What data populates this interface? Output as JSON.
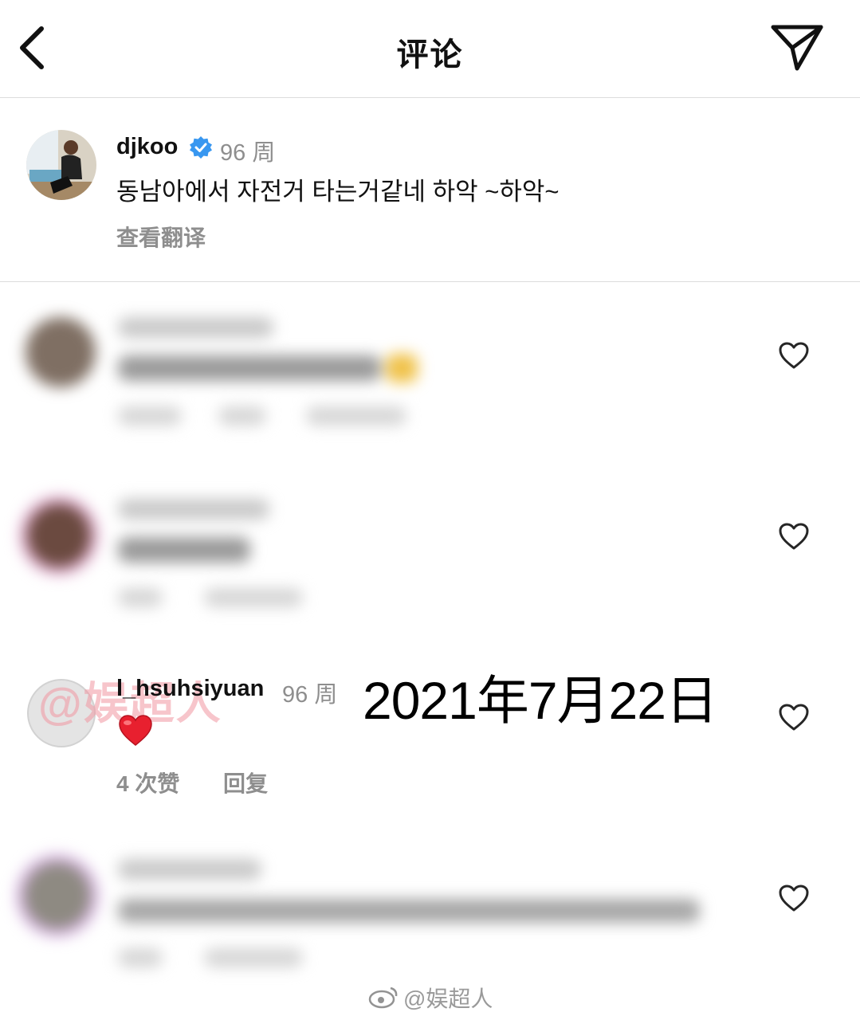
{
  "header": {
    "title": "评论",
    "back_icon": "chevron-left-icon",
    "send_icon": "paper-plane-icon"
  },
  "caption": {
    "username": "djkoo",
    "verified_icon": "verified-badge-icon",
    "time": "96 周",
    "text": "동남아에서 자전거 타는거같네 하악 ~하악~",
    "translate": "查看翻译"
  },
  "comments": [
    {
      "blurred": true
    },
    {
      "blurred": true
    },
    {
      "username": "l_hsuhsiyuan",
      "time": "96 周",
      "text": "❤️",
      "likes": "4 次赞",
      "reply": "回复"
    },
    {
      "blurred": true
    }
  ],
  "overlay": {
    "date_stamp": "2021年7月22日",
    "watermark_left": "@娱超人",
    "watermark_bottom": "@娱超人"
  },
  "colors": {
    "muted": "#8e8e8e",
    "verified": "#3897f0",
    "heart": "#e0245e"
  }
}
